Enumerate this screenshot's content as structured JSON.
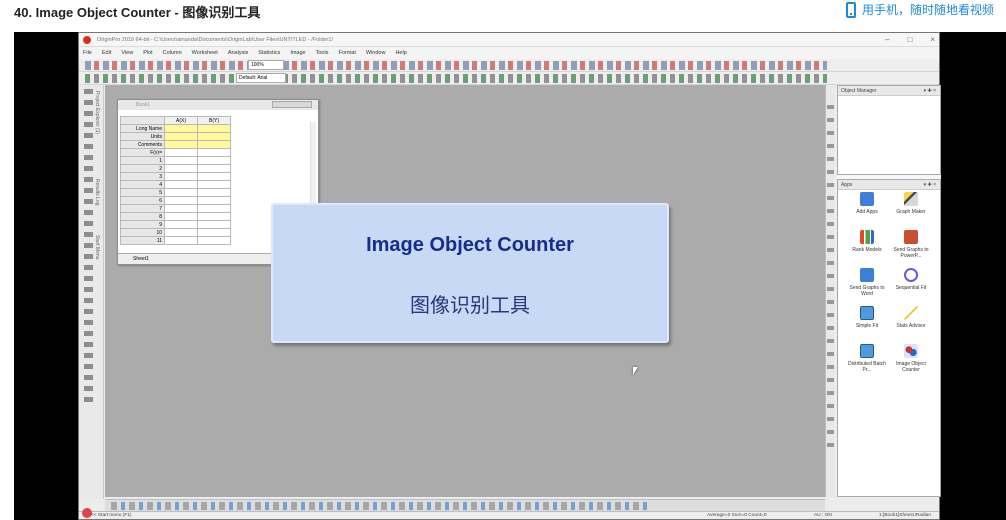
{
  "page": {
    "title": "40. Image Object Counter - 图像识别工具",
    "mobile_link": "用手机，随时随地看视频"
  },
  "app": {
    "title": "OriginPro 2019 64-bit - C:\\Users\\amanda\\Documents\\OriginLab\\User Files\\UNTITLED - /Folder1/",
    "menu": [
      "File",
      "Edit",
      "View",
      "Plot",
      "Column",
      "Worksheet",
      "Analysis",
      "Statistics",
      "Image",
      "Tools",
      "Format",
      "Window",
      "Help"
    ],
    "zoom": "100%",
    "font": "Default: Arial"
  },
  "workbook": {
    "title": "Book1",
    "columns": [
      "A(X)",
      "B(Y)"
    ],
    "row_labels": [
      "Long Name",
      "Units",
      "Comments",
      "F(x)=",
      "1",
      "2",
      "3",
      "4",
      "5",
      "6",
      "7",
      "8",
      "9",
      "10",
      "11"
    ],
    "sheet_tab": "Sheet1"
  },
  "dialog": {
    "title": "Image Object Counter",
    "subtitle": "图像识别工具"
  },
  "side_panels": {
    "object_manager": "Object Manager",
    "apps": "Apps",
    "items": [
      {
        "label": "Add Apps",
        "icon": "add-apps-icon"
      },
      {
        "label": "Graph Maker",
        "icon": "graph-maker-icon"
      },
      {
        "label": "Rank Models",
        "icon": "rank-models-icon"
      },
      {
        "label": "Send Graphs to PowerP...",
        "icon": "powerpoint-icon"
      },
      {
        "label": "Send Graphs to Word",
        "icon": "word-icon"
      },
      {
        "label": "Sequential Fit",
        "icon": "sequential-fit-icon"
      },
      {
        "label": "Simple Fit",
        "icon": "simple-fit-icon"
      },
      {
        "label": "Stats Advisor",
        "icon": "stats-advisor-icon"
      },
      {
        "label": "Distributed Batch Pr...",
        "icon": "distributed-batch-icon"
      },
      {
        "label": "Image Object Counter",
        "icon": "image-object-counter-icon"
      }
    ]
  },
  "status": {
    "start_menu": "<< Start menu (F1)",
    "summary": "Average=0 Sum=0 Count=0",
    "units": "AU : ON",
    "location": "1:[Book1]Sheet1!Radian"
  },
  "left_labels": [
    "Project Explorer (1)",
    "Results Log",
    "Start Menu"
  ]
}
